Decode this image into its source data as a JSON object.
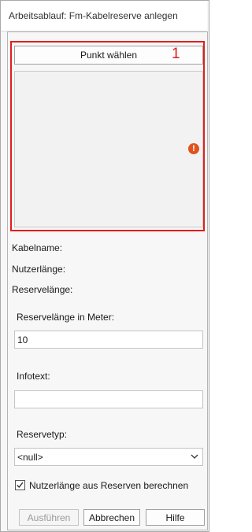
{
  "window": {
    "title": "Arbeitsablauf: Fm-Kabelreserve anlegen"
  },
  "point": {
    "button_label": "Punkt wählen",
    "marker": "1",
    "error_glyph": "!"
  },
  "info": {
    "kabelname": "Kabelname:",
    "nutzerlaenge": "Nutzerlänge:",
    "reservelaenge": "Reservelänge:"
  },
  "form": {
    "reservelaenge_label": "Reservelänge in Meter:",
    "reservelaenge_value": "10",
    "infotext_label": "Infotext:",
    "infotext_value": "",
    "reservetyp_label": "Reservetyp:",
    "reservetyp_value": "<null>",
    "checkbox_label": "Nutzerlänge aus Reserven berechnen",
    "checkbox_checked": true
  },
  "actions": {
    "execute_label": "Ausführen",
    "cancel_label": "Abbrechen",
    "help_label": "Hilfe"
  },
  "colors": {
    "highlight": "#e11d1d",
    "error_icon": "#e0531f"
  }
}
